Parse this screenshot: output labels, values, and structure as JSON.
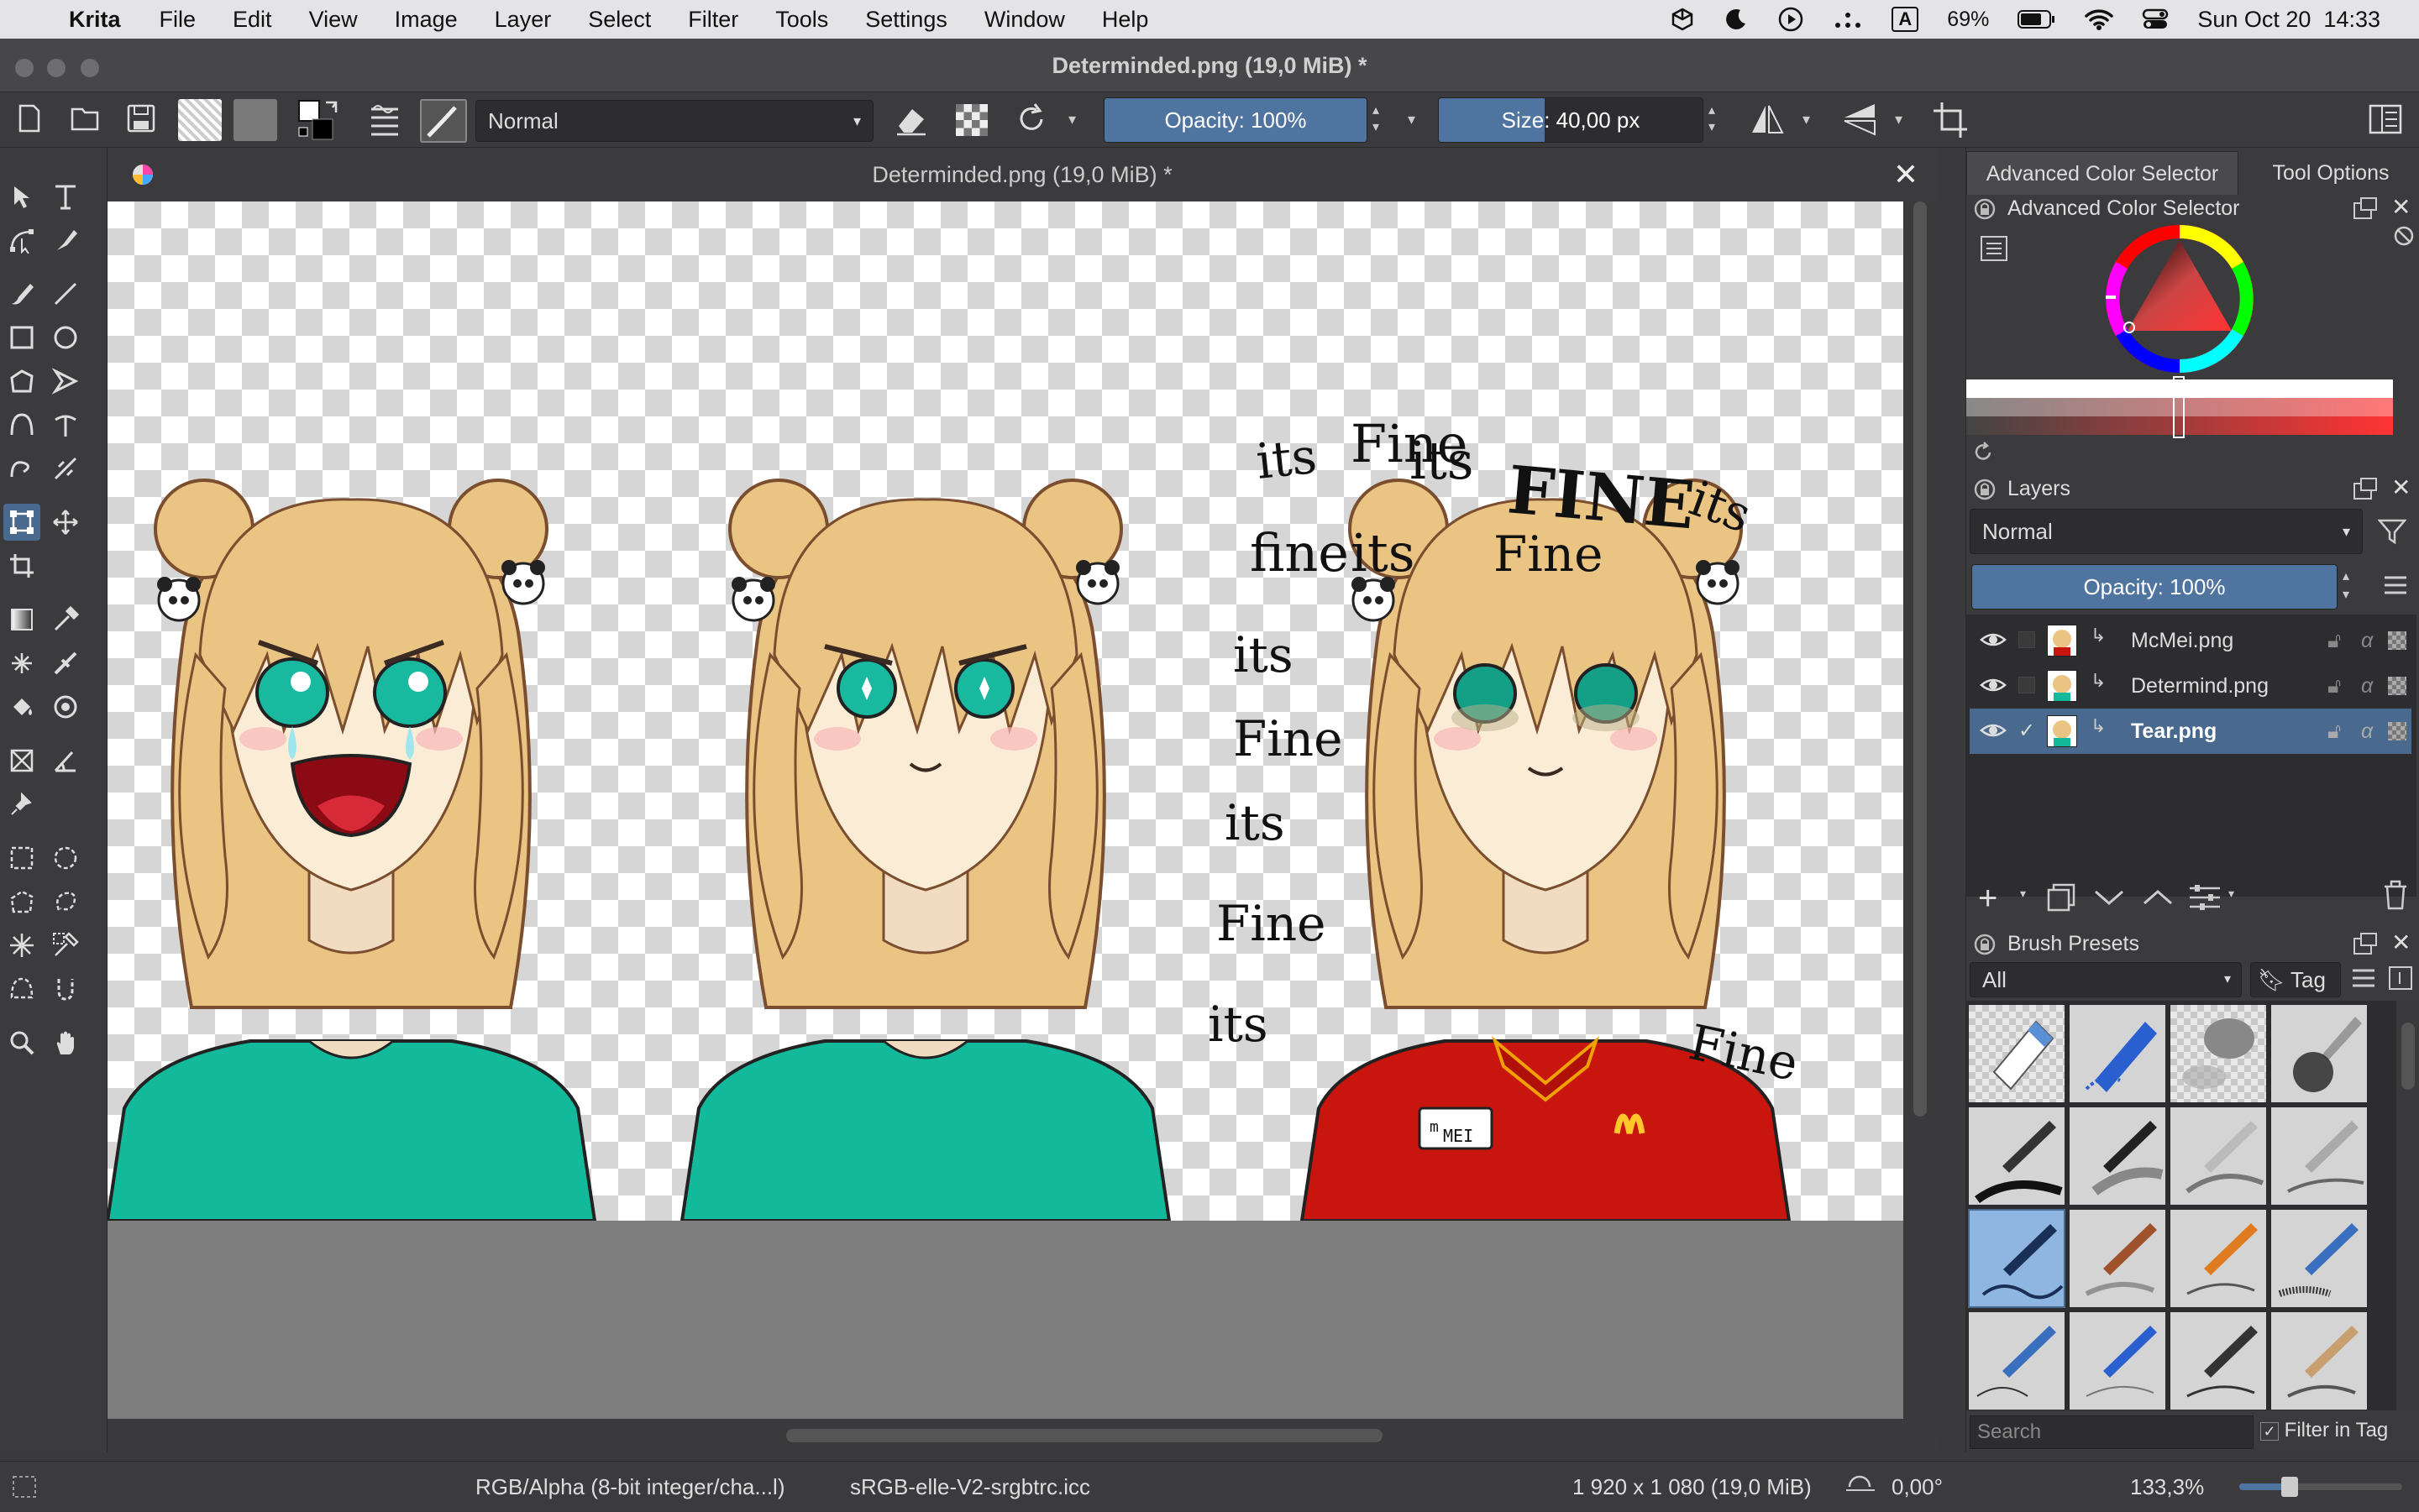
{
  "menubar": {
    "app": "Krita",
    "items": [
      "File",
      "Edit",
      "View",
      "Image",
      "Layer",
      "Select",
      "Filter",
      "Tools",
      "Settings",
      "Window",
      "Help"
    ],
    "battery": "69%",
    "datetime": "Sun Oct 20  14:33"
  },
  "window": {
    "title": "Determinded.png (19,0 MiB) *"
  },
  "toolbar": {
    "blend_mode": "Normal",
    "opacity": "Opacity: 100%",
    "opacity_fraction": 1.0,
    "size": "Size: 40,00 px",
    "size_fraction": 0.4
  },
  "document": {
    "tab_title": "Determinded.png (19,0 MiB) *"
  },
  "dock": {
    "tabs": [
      "Advanced Color Selector",
      "Tool Options"
    ],
    "color_selector_title": "Advanced Color Selector",
    "layers_title": "Layers",
    "layer_blend": "Normal",
    "layer_opacity": "Opacity:  100%",
    "layers": [
      {
        "name": "McMei.png",
        "visible": true,
        "checked": false,
        "selected": false
      },
      {
        "name": "Determind.png",
        "visible": true,
        "checked": false,
        "selected": false
      },
      {
        "name": "Tear.png",
        "visible": true,
        "checked": true,
        "selected": true
      }
    ],
    "brush_presets_title": "Brush Presets",
    "brush_filter": "All",
    "brush_tag": "Tag",
    "search_placeholder": "Search",
    "filter_in_tag": "Filter in Tag"
  },
  "canvas_text": {
    "handwriting": [
      "its",
      "Fine",
      "its",
      "FINE",
      "its",
      "fine",
      "its",
      "Fine",
      "its",
      "Fine",
      "its",
      "Fine",
      "its",
      "Fine"
    ],
    "name_tag": "MEI",
    "name_tag_letter": "m"
  },
  "status": {
    "color_model": "RGB/Alpha (8-bit integer/cha...l)",
    "profile": "sRGB-elle-V2-srgbtrc.icc",
    "dimensions": "1 920 x 1 080 (19,0 MiB)",
    "rotation": "0,00°",
    "zoom": "133,3%"
  },
  "colors": {
    "accent": "#49698e",
    "shirt_teal": "#12b99a",
    "shirt_red": "#c8150e",
    "hair": "#e9c483"
  }
}
